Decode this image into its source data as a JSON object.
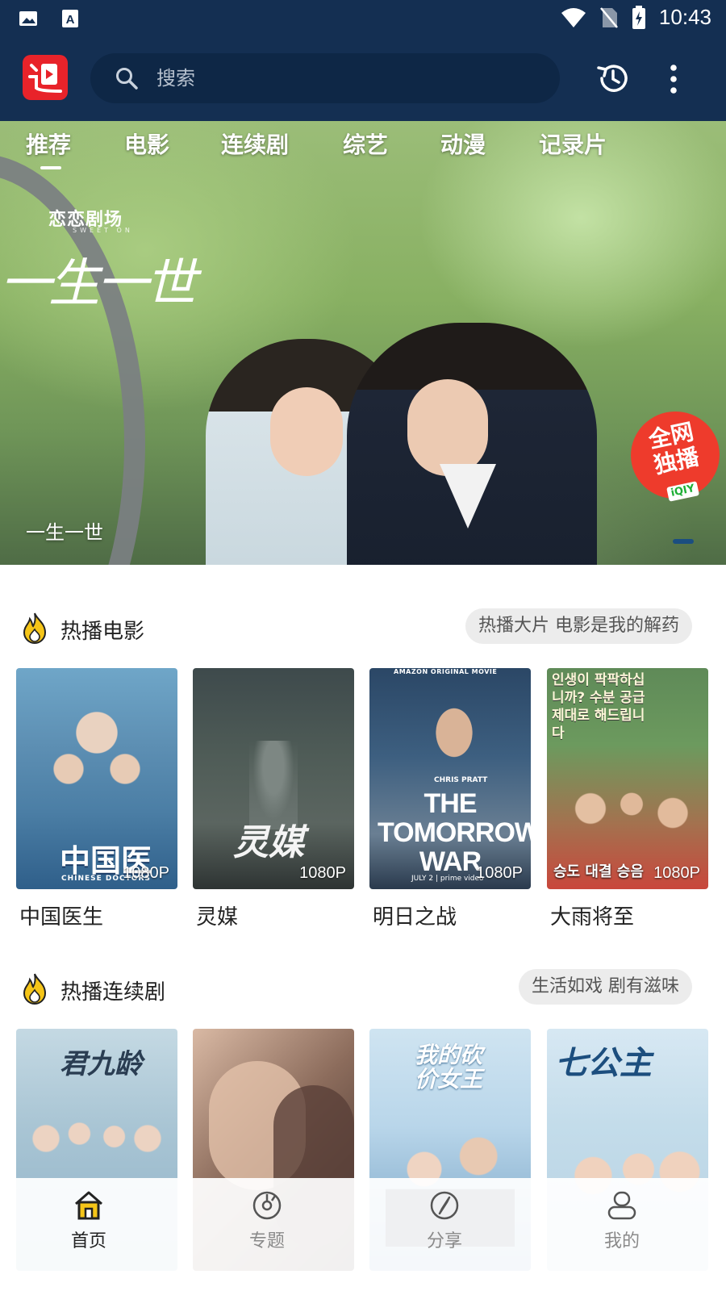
{
  "status_bar": {
    "time": "10:43"
  },
  "search": {
    "placeholder": "搜索"
  },
  "categories": [
    "推荐",
    "电影",
    "连续剧",
    "综艺",
    "动漫",
    "记录片"
  ],
  "banner": {
    "brand": "恋恋剧场",
    "brand_sub": "SWEET ON",
    "title_art": "一生一世",
    "badge_line1": "全网",
    "badge_line2": "独播",
    "badge_sub": "iQIY",
    "caption": "一生一世"
  },
  "movies_section": {
    "title": "热播电影",
    "slogan": "热播大片 电影是我的解药",
    "items": [
      {
        "title": "中国医生",
        "quality": "1080P",
        "poster_text": "中国医生",
        "poster_sub": "CHINESE DOCTORS"
      },
      {
        "title": "灵媒",
        "quality": "1080P",
        "poster_text": "灵媒"
      },
      {
        "title": "明日之战",
        "quality": "1080P",
        "poster_top": "AMAZON ORIGINAL MOVIE",
        "poster_text": "THE TOMORROW WAR",
        "poster_actor": "CHRIS PRATT",
        "poster_date": "JULY 2 | prime video"
      },
      {
        "title": "大雨将至",
        "quality": "1080P",
        "poster_text": "인생이 팍팍하십니까? 수분 공급 제대로 해드립니다",
        "poster_bottom": "승도 대결 승음"
      }
    ]
  },
  "series_section": {
    "title": "热播连续剧",
    "slogan": "生活如戏 剧有滋味",
    "items": [
      {
        "poster_text": "君九龄"
      },
      {
        "poster_text": ""
      },
      {
        "poster_text": "我的砍价女王"
      },
      {
        "poster_text": "七公主"
      }
    ]
  },
  "bottom_nav": [
    {
      "label": "首页",
      "icon": "home-icon",
      "active": true
    },
    {
      "label": "专题",
      "icon": "disc-icon",
      "active": false
    },
    {
      "label": "分享",
      "icon": "compass-icon",
      "active": false
    },
    {
      "label": "我的",
      "icon": "user-icon",
      "active": false
    }
  ],
  "colors": {
    "top_bar": "#142f52",
    "accent_red": "#e8232a",
    "fire": "#f5c518"
  }
}
